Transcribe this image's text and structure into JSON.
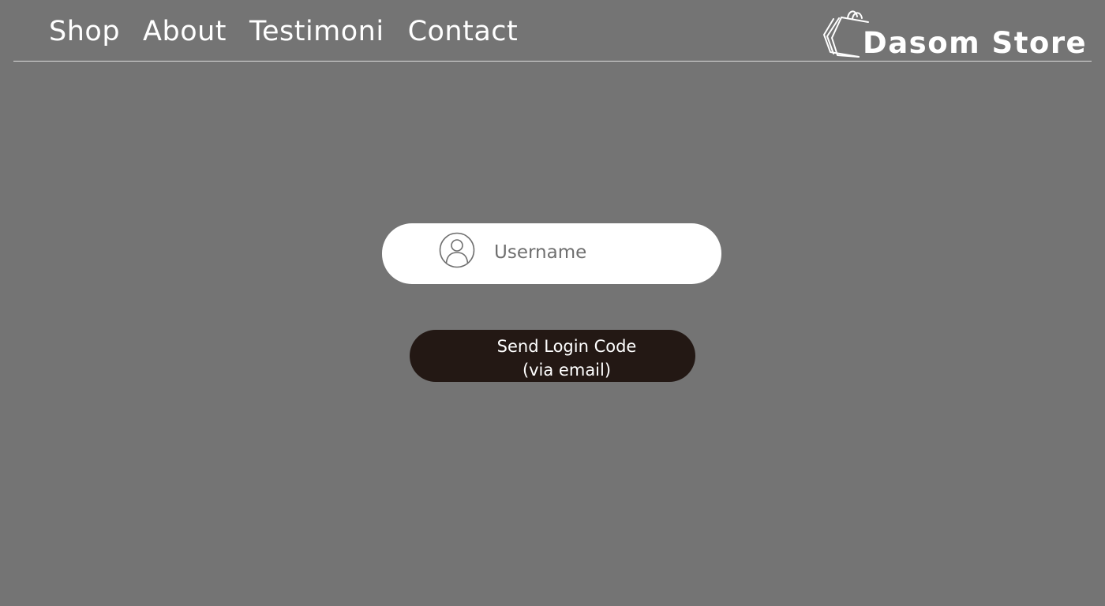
{
  "nav": {
    "items": [
      {
        "label": "Shop"
      },
      {
        "label": "About"
      },
      {
        "label": "Testimoni"
      },
      {
        "label": "Contact"
      }
    ]
  },
  "brand": {
    "name": "Dasom Store",
    "icon": "shopping-bags-icon"
  },
  "login": {
    "username_placeholder": "Username",
    "username_value": "",
    "user_icon": "user-circle-icon",
    "send_button_line1": "Send Login Code",
    "send_button_line2": "(via email)"
  },
  "colors": {
    "background": "#747474",
    "field": "#ffffff",
    "button": "#231814",
    "text": "#ffffff",
    "placeholder": "#6f6f6f"
  }
}
